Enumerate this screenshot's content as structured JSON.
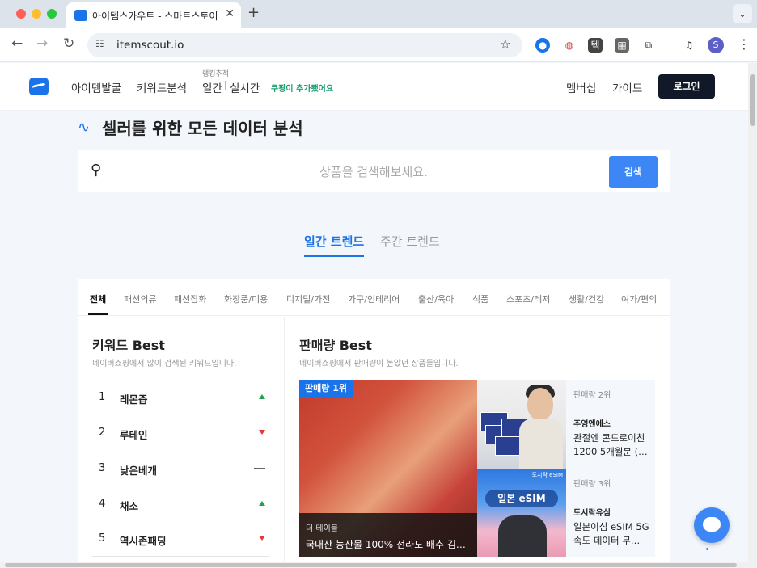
{
  "browser": {
    "tab_title": "아이템스카우트 - 스마트스토어 및 ",
    "url": "itemscout.io",
    "profile_initial": "S",
    "icons": [
      "back-icon",
      "forward-icon",
      "reload-icon",
      "site-info-icon",
      "star-icon",
      "extensions-icon",
      "media-icon",
      "kebab-menu-icon"
    ]
  },
  "header": {
    "nav": [
      "아이템발굴",
      "키워드분석"
    ],
    "rank_label": "랭킹추적",
    "rank_daily": "일간",
    "rank_realtime": "실시간",
    "coupang": "쿠팡이 추가됐어요",
    "membership": "멤버십",
    "guide": "가이드",
    "login": "로그인"
  },
  "hero": {
    "title": "셀러를 위한 모든 데이터 분석",
    "search_placeholder": "상품을 검색해보세요.",
    "search_button": "검색"
  },
  "trend_tabs": {
    "daily": "일간 트렌드",
    "weekly": "주간 트렌드"
  },
  "categories": [
    "전체",
    "패션의류",
    "패션잡화",
    "화장품/미용",
    "디지털/가전",
    "가구/인테리어",
    "출산/육아",
    "식품",
    "스포츠/레저",
    "생활/건강",
    "여가/편의"
  ],
  "keyword_best": {
    "title": "키워드 Best",
    "subtitle": "네이버쇼핑에서 많이 검색된 키워드입니다.",
    "items": [
      {
        "rank": "1",
        "name": "레몬즙",
        "trend": "up"
      },
      {
        "rank": "2",
        "name": "루테인",
        "trend": "down"
      },
      {
        "rank": "3",
        "name": "낮은베개",
        "trend": "same"
      },
      {
        "rank": "4",
        "name": "채소",
        "trend": "up"
      },
      {
        "rank": "5",
        "name": "역시존패딩",
        "trend": "down"
      }
    ]
  },
  "sales_best": {
    "title": "판매량 Best",
    "subtitle": "네이버쇼핑에서 판매량이 높았던 상품들입니다.",
    "first": {
      "badge": "판매량 1위",
      "store": "더 테이블",
      "name": "국내산 농산물 100% 전라도 배추 김치…"
    },
    "second": {
      "rank": "판매량 2위",
      "store": "주영엔에스",
      "name": "관절엔 콘드로이친 1200 5개월분 (…"
    },
    "third": {
      "rank": "판매량 3위",
      "store": "도시락유심",
      "name": "일본이심 eSIM 5G 속도 데이터 무…",
      "image_text": "일본 eSIM",
      "image_brand": "도시락 eSIM"
    }
  }
}
